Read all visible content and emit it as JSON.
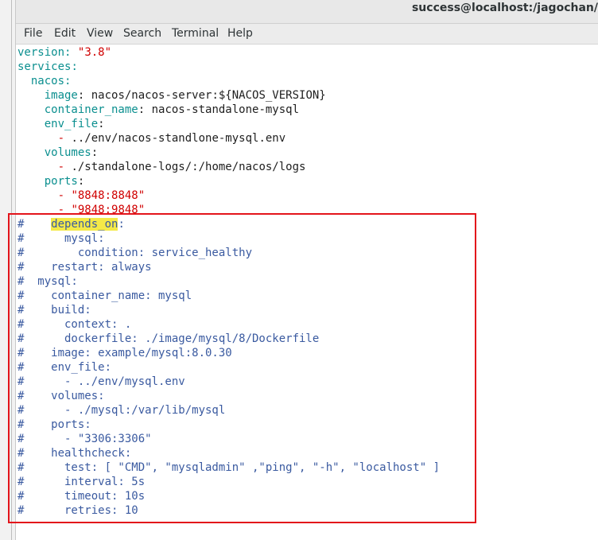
{
  "window": {
    "title": "success@localhost:/jagochan/"
  },
  "menu": {
    "items": [
      "File",
      "Edit",
      "View",
      "Search",
      "Terminal",
      "Help"
    ]
  },
  "colors": {
    "key": "#0b8f8f",
    "string": "#d00000",
    "comment": "#3a5aa0",
    "highlight": "#f4e948",
    "annotation_box": "#e3141b"
  },
  "code": {
    "l1": {
      "k": "version",
      "s": ":",
      "v": "\"3.8\""
    },
    "l2": {
      "k": "services",
      "s": ":"
    },
    "l3": {
      "i": "  ",
      "k": "nacos",
      "s": ":"
    },
    "l4": {
      "i": "    ",
      "k": "image",
      "s": ": ",
      "v": "nacos/nacos-server:${NACOS_VERSION}"
    },
    "l5": {
      "i": "    ",
      "k": "container_name",
      "s": ": ",
      "v": "nacos-standalone-mysql"
    },
    "l6": {
      "i": "    ",
      "k": "env_file",
      "s": ":"
    },
    "l7": {
      "i": "      ",
      "k": "-",
      "v": " ../env/nacos-standlone-mysql.env"
    },
    "l8": {
      "i": "    ",
      "k": "volumes",
      "s": ":"
    },
    "l9": {
      "i": "      ",
      "k": "-",
      "v": " ./standalone-logs/:/home/nacos/logs"
    },
    "l10": {
      "i": "    ",
      "k": "ports",
      "s": ":"
    },
    "l11": {
      "i": "      ",
      "k": "- ",
      "v": "\"8848:8848\""
    },
    "l12": {
      "i": "      ",
      "k": "- ",
      "v": "\"9848:9848\""
    },
    "c1": {
      "a": "#    ",
      "h": "depends_on",
      "b": ":"
    },
    "c2": "#      mysql:",
    "c3": "#        condition: service_healthy",
    "c4": "#    restart: always",
    "c5": "#  mysql:",
    "c6": "#    container_name: mysql",
    "c7": "#    build:",
    "c8": "#      context: .",
    "c9": "#      dockerfile: ./image/mysql/8/Dockerfile",
    "c10": "#    image: example/mysql:8.0.30",
    "c11": "#    env_file:",
    "c12": "#      - ../env/mysql.env",
    "c13": "#    volumes:",
    "c14": "#      - ./mysql:/var/lib/mysql",
    "c15": "#    ports:",
    "c16": "#      - \"3306:3306\"",
    "c17": "#    healthcheck:",
    "c18": "#      test: [ \"CMD\", \"mysqladmin\" ,\"ping\", \"-h\", \"localhost\" ]",
    "c19": "#      interval: 5s",
    "c20": "#      timeout: 10s",
    "c21": "#      retries: 10"
  }
}
